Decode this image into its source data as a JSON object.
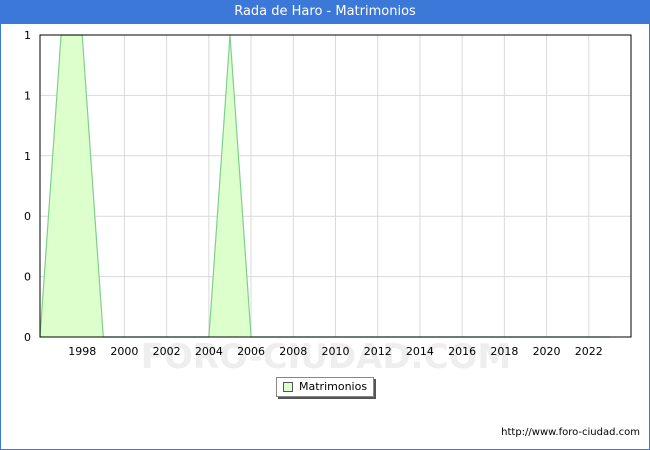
{
  "header": {
    "title": "Rada de Haro - Matrimonios"
  },
  "watermark": "FORO-CIUDAD.COM",
  "credit": "http://www.foro-ciudad.com",
  "colors": {
    "titlebar": "#3c78d8",
    "area_fill": "#ddffcc",
    "area_line": "#7fcf8f",
    "grid": "#d9d9d9"
  },
  "chart_data": {
    "type": "area",
    "title": "Rada de Haro - Matrimonios",
    "xlabel": "",
    "ylabel": "",
    "x": [
      1996,
      1997,
      1998,
      1999,
      2000,
      2001,
      2002,
      2003,
      2004,
      2005,
      2006,
      2007,
      2008,
      2009,
      2010,
      2011,
      2012,
      2013,
      2014,
      2015,
      2016,
      2017,
      2018,
      2019,
      2020,
      2021,
      2022,
      2023
    ],
    "series": [
      {
        "name": "Matrimonios",
        "values": [
          0,
          1,
          1,
          0,
          0,
          0,
          0,
          0,
          0,
          1,
          0,
          0,
          0,
          0,
          0,
          0,
          0,
          0,
          0,
          0,
          0,
          0,
          0,
          0,
          0,
          0,
          0,
          0
        ]
      }
    ],
    "xticks": [
      "1998",
      "2000",
      "2002",
      "2004",
      "2006",
      "2008",
      "2010",
      "2012",
      "2014",
      "2016",
      "2018",
      "2020",
      "2022"
    ],
    "yticks": [
      "0",
      "0",
      "0",
      "1",
      "1",
      "1"
    ],
    "xlim": [
      1996,
      2024
    ],
    "ylim": [
      0,
      1
    ],
    "grid": true,
    "legend": {
      "position": "bottom-center",
      "entries": [
        "Matrimonios"
      ]
    }
  }
}
